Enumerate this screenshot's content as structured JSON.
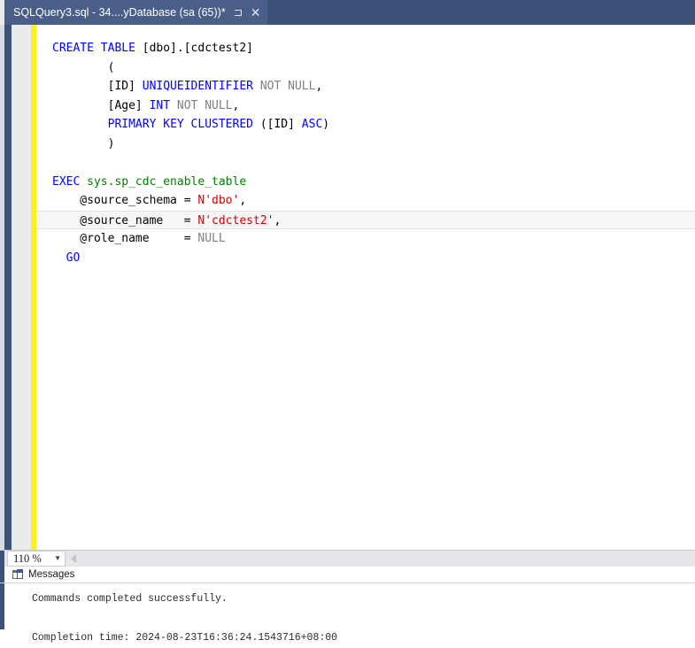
{
  "tab": {
    "title": "SQLQuery3.sql - 34....yDatabase (sa (65))*",
    "pin_icon": "⊐",
    "close_icon": "✕",
    "pin_name": "pin-tab-icon",
    "close_name": "close-tab-icon"
  },
  "editor": {
    "lines": [
      {
        "id": 1,
        "indent": 0,
        "fold": "start",
        "highlight": false,
        "tokens": [
          {
            "t": "CREATE TABLE ",
            "c": "kw"
          },
          {
            "t": "[dbo].[cdctest2]",
            "c": "blk"
          }
        ]
      },
      {
        "id": 2,
        "indent": 0,
        "fold": "body",
        "highlight": false,
        "tokens": [
          {
            "t": "        (",
            "c": "blk"
          }
        ]
      },
      {
        "id": 3,
        "indent": 0,
        "fold": "body",
        "highlight": false,
        "tokens": [
          {
            "t": "        [ID] ",
            "c": "blk"
          },
          {
            "t": "UNIQUEIDENTIFIER",
            "c": "kw"
          },
          {
            "t": " ",
            "c": "blk"
          },
          {
            "t": "NOT NULL",
            "c": "gry"
          },
          {
            "t": ",",
            "c": "blk"
          }
        ]
      },
      {
        "id": 4,
        "indent": 0,
        "fold": "body",
        "highlight": false,
        "tokens": [
          {
            "t": "        [Age] ",
            "c": "blk"
          },
          {
            "t": "INT",
            "c": "kw"
          },
          {
            "t": " ",
            "c": "blk"
          },
          {
            "t": "NOT NULL",
            "c": "gry"
          },
          {
            "t": ",",
            "c": "blk"
          }
        ]
      },
      {
        "id": 5,
        "indent": 0,
        "fold": "body",
        "highlight": false,
        "tokens": [
          {
            "t": "        ",
            "c": "blk"
          },
          {
            "t": "PRIMARY KEY CLUSTERED",
            "c": "kw"
          },
          {
            "t": " ([ID] ",
            "c": "blk"
          },
          {
            "t": "ASC",
            "c": "kw"
          },
          {
            "t": ")",
            "c": "blk"
          }
        ]
      },
      {
        "id": 6,
        "indent": 0,
        "fold": "end",
        "highlight": false,
        "tokens": [
          {
            "t": "        )",
            "c": "blk"
          }
        ]
      },
      {
        "id": 7,
        "indent": 0,
        "fold": "none",
        "highlight": false,
        "tokens": [
          {
            "t": "",
            "c": "blk"
          }
        ]
      },
      {
        "id": 8,
        "indent": 0,
        "fold": "start",
        "highlight": false,
        "tokens": [
          {
            "t": "EXEC ",
            "c": "kw"
          },
          {
            "t": "sys.sp_cdc_enable_table",
            "c": "grn"
          }
        ]
      },
      {
        "id": 9,
        "indent": 0,
        "fold": "body",
        "highlight": false,
        "tokens": [
          {
            "t": "    @source_schema = ",
            "c": "blk"
          },
          {
            "t": "N'dbo'",
            "c": "red"
          },
          {
            "t": ",",
            "c": "blk"
          }
        ]
      },
      {
        "id": 10,
        "indent": 0,
        "fold": "body",
        "highlight": true,
        "tokens": [
          {
            "t": "    @source_name   = ",
            "c": "blk"
          },
          {
            "t": "N'cdctest2'",
            "c": "red"
          },
          {
            "t": ",",
            "c": "blk"
          }
        ]
      },
      {
        "id": 11,
        "indent": 0,
        "fold": "end",
        "highlight": false,
        "tokens": [
          {
            "t": "    @role_name     = ",
            "c": "blk"
          },
          {
            "t": "NULL",
            "c": "gry"
          }
        ]
      },
      {
        "id": 12,
        "indent": 0,
        "fold": "none",
        "highlight": false,
        "tokens": [
          {
            "t": "  ",
            "c": "blk"
          },
          {
            "t": "GO",
            "c": "kw"
          }
        ]
      }
    ]
  },
  "status": {
    "zoom_level": "110 %",
    "zoom_caret_icon": "▼"
  },
  "messages": {
    "tab_label": "Messages",
    "tab_icon": "grid-icon",
    "lines": [
      "Commands completed successfully.",
      "",
      "Completion time: 2024-08-23T16:36:24.1543716+08:00"
    ]
  }
}
